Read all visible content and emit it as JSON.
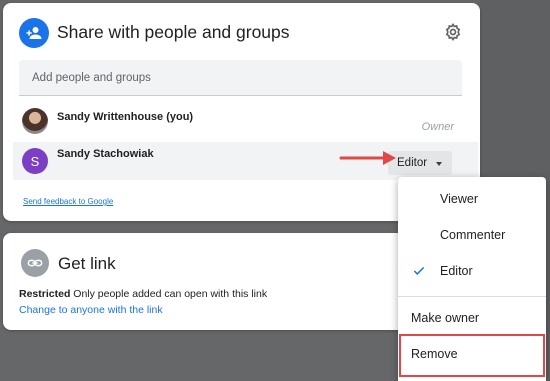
{
  "share": {
    "title": "Share with people and groups",
    "search_placeholder": "Add people and groups",
    "people": [
      {
        "name": "Sandy Writtenhouse (you)",
        "role": "Owner"
      },
      {
        "name": "Sandy Stachowiak",
        "role": "Editor",
        "avatar_letter": "S"
      }
    ],
    "feedback_link": "Send feedback to Google"
  },
  "role_menu": {
    "items": [
      "Viewer",
      "Commenter",
      "Editor"
    ],
    "selected": "Editor",
    "make_owner": "Make owner",
    "remove": "Remove"
  },
  "get_link": {
    "title": "Get link",
    "restricted_label": "Restricted",
    "restricted_desc": "Only people added can open with this link",
    "change_link": "Change to anyone with the link"
  },
  "colors": {
    "accent": "#1a73e8",
    "avatar_purple": "#7b3fc4",
    "highlight": "#e04848"
  }
}
